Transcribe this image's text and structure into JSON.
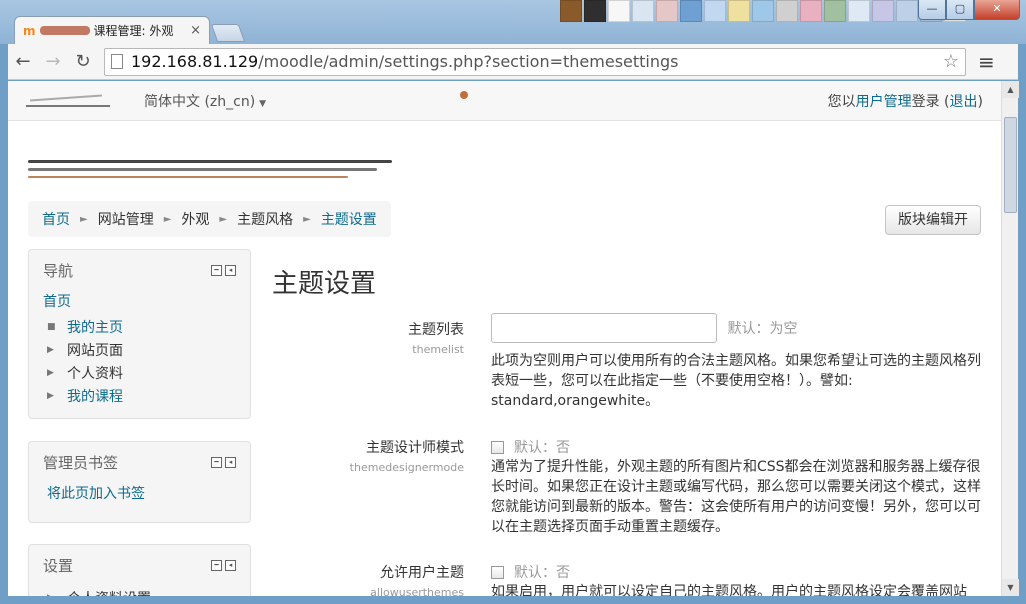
{
  "browser": {
    "tab_title": "课程管理: 外观",
    "tab_close": "×",
    "url_host": "192.168.81.129",
    "url_path": "/moodle/admin/settings.php?section=themesettings",
    "win_minimize": "—",
    "win_maximize": "▢",
    "win_close": "✕",
    "colors": [
      "#8b5a2b",
      "#2f2f2f",
      "#f7f7f7",
      "#d9e6f2",
      "#e6c7c7",
      "#6fa0d3",
      "#c0d9f0",
      "#f0e0a0",
      "#9ec7e8",
      "#d0d0d0",
      "#e8b0c0",
      "#a0c0a0",
      "#dfe9f5",
      "#c6c6e6",
      "#bcd0e8",
      "#a8b8d0",
      "#e0e0e0"
    ]
  },
  "navbar": {
    "language": "简体中文 (zh_cn)",
    "login_prefix": "您以",
    "login_user": "用户管理",
    "login_mid": "登录 (",
    "logout": "退出",
    "login_suffix": ")"
  },
  "breadcrumb": {
    "items": [
      "首页",
      "网站管理",
      "外观",
      "主题风格",
      "主题设置"
    ],
    "sep": "►"
  },
  "edit_button": "版块编辑开",
  "blocks": {
    "navigation": {
      "title": "导航",
      "home": "首页",
      "items": [
        "我的主页",
        "网站页面",
        "个人资料",
        "我的课程"
      ]
    },
    "bookmarks": {
      "title": "管理员书签",
      "add": "将此页加入书签"
    },
    "settings": {
      "title": "设置",
      "items": [
        "个人资料设置"
      ]
    }
  },
  "page_title": "主题设置",
  "settings": [
    {
      "label": "主题列表",
      "key": "themelist",
      "default": "默认：为空",
      "value": "",
      "description": "此项为空则用户可以使用所有的合法主题风格。如果您希望让可选的主题风格列表短一些，您可以在此指定一些（不要使用空格！）。譬如: standard,orangewhite。"
    },
    {
      "label": "主题设计师模式",
      "key": "themedesignermode",
      "default": "默认：否",
      "description": "通常为了提升性能，外观主题的所有图片和CSS都会在浏览器和服务器上缓存很长时间。如果您正在设计主题或编写代码，那么您可以需要关闭这个模式，这样您就能访问到最新的版本。警告：这会使所有用户的访问变慢！另外，您可以可以在主题选择页面手动重置主题缓存。"
    },
    {
      "label": "允许用户主题",
      "key": "allowuserthemes",
      "default": "默认：否",
      "description": "如果启用，用户就可以设定自己的主题风格。用户的主题风格设定会覆盖网站"
    }
  ]
}
